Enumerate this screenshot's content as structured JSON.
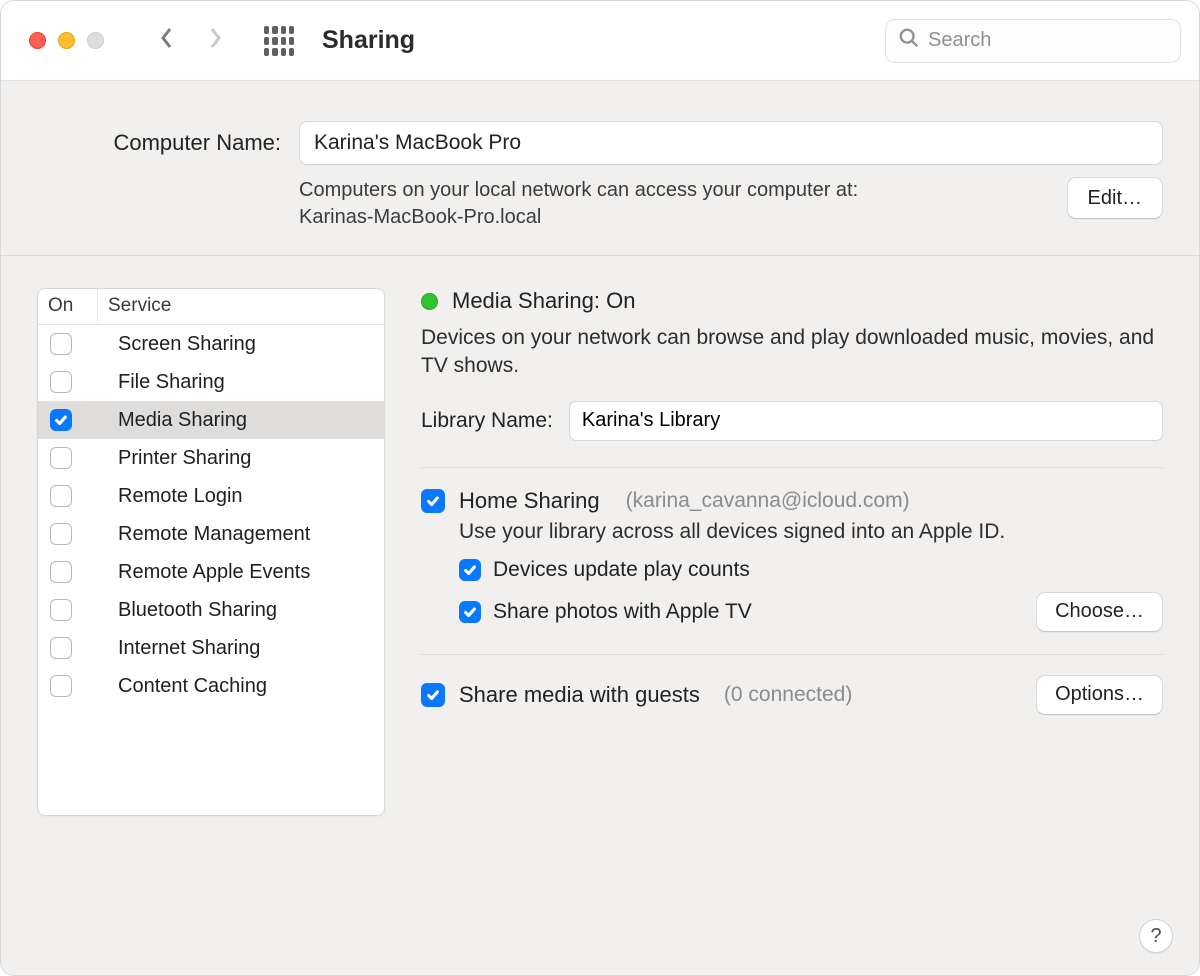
{
  "toolbar": {
    "title": "Sharing",
    "search_placeholder": "Search"
  },
  "computer_name": {
    "label": "Computer Name:",
    "value": "Karina's MacBook Pro",
    "description_line1": "Computers on your local network can access your computer at:",
    "description_line2": "Karinas-MacBook-Pro.local",
    "edit_label": "Edit…"
  },
  "services": {
    "header_on": "On",
    "header_service": "Service",
    "items": [
      {
        "label": "Screen Sharing",
        "checked": false
      },
      {
        "label": "File Sharing",
        "checked": false
      },
      {
        "label": "Media Sharing",
        "checked": true
      },
      {
        "label": "Printer Sharing",
        "checked": false
      },
      {
        "label": "Remote Login",
        "checked": false
      },
      {
        "label": "Remote Management",
        "checked": false
      },
      {
        "label": "Remote Apple Events",
        "checked": false
      },
      {
        "label": "Bluetooth Sharing",
        "checked": false
      },
      {
        "label": "Internet Sharing",
        "checked": false
      },
      {
        "label": "Content Caching",
        "checked": false
      }
    ],
    "selected_index": 2
  },
  "detail": {
    "status_text": "Media Sharing: On",
    "status_color": "#30c330",
    "description": "Devices on your network can browse and play downloaded music, movies, and TV shows.",
    "library_label": "Library Name:",
    "library_value": "Karina's Library",
    "home_sharing": {
      "checked": true,
      "label": "Home Sharing",
      "account": "(karina_cavanna@icloud.com)",
      "description": "Use your library across all devices signed into an Apple ID.",
      "update_play_counts": {
        "checked": true,
        "label": "Devices update play counts"
      },
      "share_photos": {
        "checked": true,
        "label": "Share photos with Apple TV"
      },
      "choose_label": "Choose…"
    },
    "guests": {
      "checked": true,
      "label": "Share media with guests",
      "sub": "(0 connected)",
      "options_label": "Options…"
    }
  },
  "help_label": "?"
}
